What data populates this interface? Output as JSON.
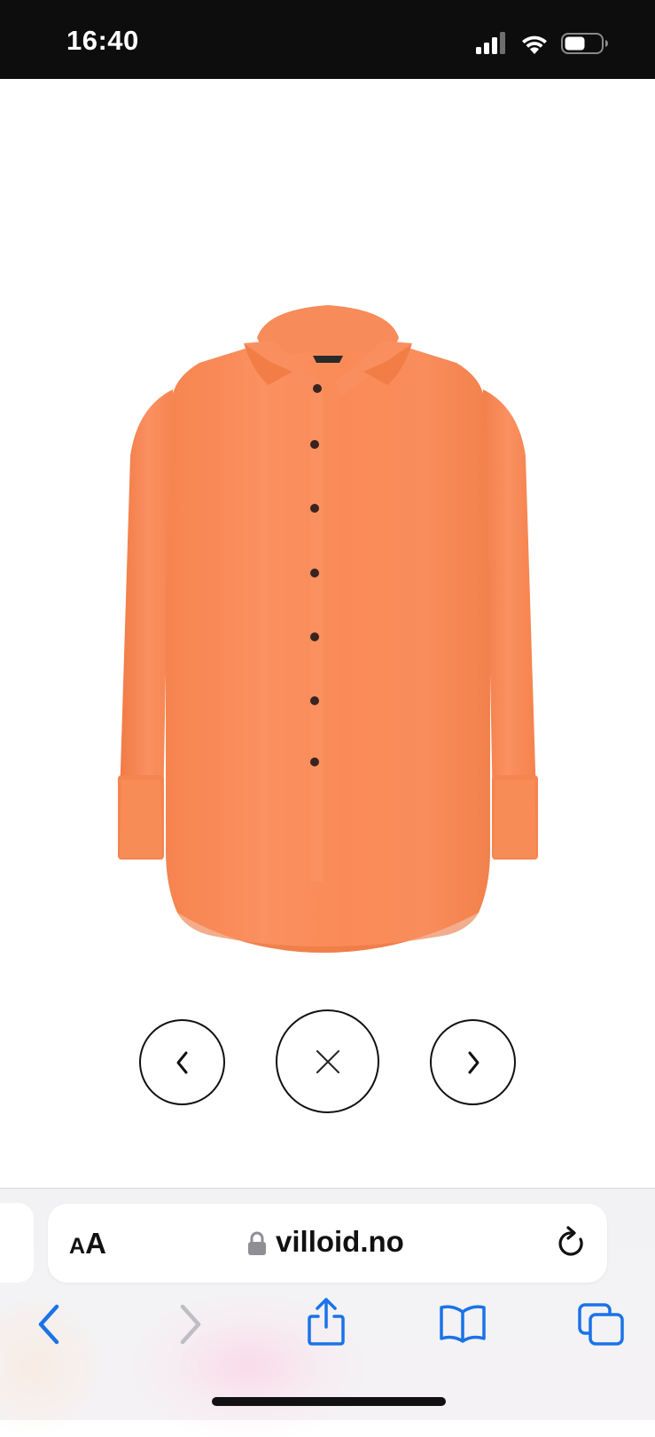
{
  "status_bar": {
    "time": "16:40"
  },
  "product": {
    "image_icon": "orange-satin-shirt-image",
    "colors": {
      "shirt": "#F98A55",
      "buttons": "#3a2420"
    }
  },
  "gallery_controls": {
    "prev_icon": "chevron-left-icon",
    "close_icon": "close-icon",
    "next_icon": "chevron-right-icon"
  },
  "browser": {
    "text_size_small": "A",
    "text_size_large": "A",
    "url": "villoid.no",
    "accent": "#1a73e8"
  }
}
